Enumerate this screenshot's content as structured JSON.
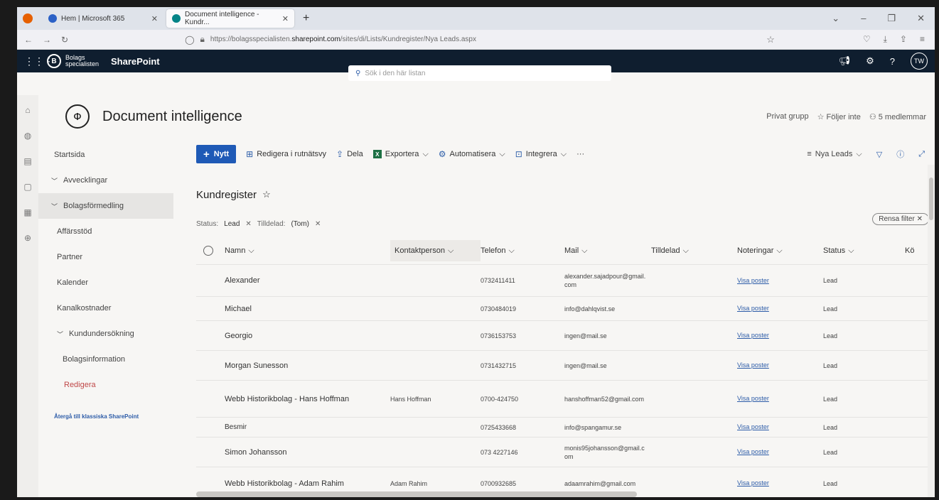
{
  "browser": {
    "tabs": [
      {
        "label": "Hem | Microsoft 365"
      },
      {
        "label": "Document intelligence - Kundr..."
      }
    ],
    "url_prefix": "https://bolagsspecialisten.",
    "url_domain": "sharepoint.com",
    "url_path": "/sites/di/Lists/Kundregister/Nya Leads.aspx"
  },
  "suite": {
    "org_line1": "Bolags",
    "org_line2": "specialisten",
    "brand": "SharePoint",
    "search_placeholder": "Sök i den här listan",
    "avatar": "TW"
  },
  "site": {
    "title": "Document intelligence",
    "group_type": "Privat grupp",
    "follow": "Följer inte",
    "members": "5 medlemmar"
  },
  "leftnav": {
    "items": [
      {
        "label": "Startsida",
        "type": "top"
      },
      {
        "label": "Avvecklingar",
        "type": "group"
      },
      {
        "label": "Bolagsförmedling",
        "type": "group",
        "active": true
      },
      {
        "label": "Affärsstöd",
        "type": "sub"
      },
      {
        "label": "Partner",
        "type": "sub"
      },
      {
        "label": "Kalender",
        "type": "sub"
      },
      {
        "label": "Kanalkostnader",
        "type": "sub"
      },
      {
        "label": "Kundundersökning",
        "type": "group"
      },
      {
        "label": "Bolagsinformation",
        "type": "subsub"
      },
      {
        "label": "Redigera",
        "type": "edit"
      }
    ],
    "classic_link": "Återgå till klassiska SharePoint"
  },
  "commandbar": {
    "new": "Nytt",
    "grid_edit": "Redigera i rutnätsvy",
    "share": "Dela",
    "export": "Exportera",
    "automate": "Automatisera",
    "integrate": "Integrera",
    "more": "···",
    "view": "Nya Leads"
  },
  "list": {
    "title": "Kundregister",
    "filter_status_label": "Status:",
    "filter_status_value": "Lead",
    "filter_assigned_label": "Tilldelad:",
    "filter_assigned_value": "(Tom)",
    "clear_filter": "Rensa filter",
    "columns": [
      "Namn",
      "Kontaktperson",
      "Telefon",
      "Mail",
      "Tilldelad",
      "Noteringar",
      "Status",
      "Kö"
    ],
    "rows": [
      {
        "namn": "Alexander",
        "kontakt": "",
        "telefon": "0732411411",
        "mail": "alexander.sajadpour@gmail.com",
        "noteringar": "Visa poster",
        "status": "Lead"
      },
      {
        "namn": "Michael",
        "kontakt": "",
        "telefon": "0730484019",
        "mail": "info@dahlqvist.se",
        "noteringar": "Visa poster",
        "status": "Lead"
      },
      {
        "namn": "Georgio",
        "kontakt": "",
        "telefon": "0736153753",
        "mail": "ingen@mail.se",
        "noteringar": "Visa poster",
        "status": "Lead"
      },
      {
        "namn": "Morgan Sunesson",
        "kontakt": "",
        "telefon": "0731432715",
        "mail": "ingen@mail.se",
        "noteringar": "Visa poster",
        "status": "Lead"
      },
      {
        "namn": "Webb Historikbolag - Hans Hoffman",
        "kontakt": "Hans Hoffman",
        "telefon": "0700-424750",
        "mail": "hanshoffman52@gmail.com",
        "noteringar": "Visa poster",
        "status": "Lead"
      },
      {
        "namn": "Besmir",
        "kontakt": "",
        "telefon": "0725433668",
        "mail": "info@spangamur.se",
        "noteringar": "Visa poster",
        "status": "Lead"
      },
      {
        "namn": "Simon Johansson",
        "kontakt": "",
        "telefon": "073 4227146",
        "mail": "monis95johansson@gmail.com",
        "noteringar": "Visa poster",
        "status": "Lead"
      },
      {
        "namn": "Webb Historikbolag - Adam Rahim",
        "kontakt": "Adam Rahim",
        "telefon": "0700932685",
        "mail": "adaamrahim@gmail.com",
        "noteringar": "Visa poster",
        "status": "Lead"
      }
    ]
  },
  "colors": {
    "suite_bg": "#0f1e2f",
    "accent": "#1f5ab6",
    "link": "#2d5ca8"
  }
}
